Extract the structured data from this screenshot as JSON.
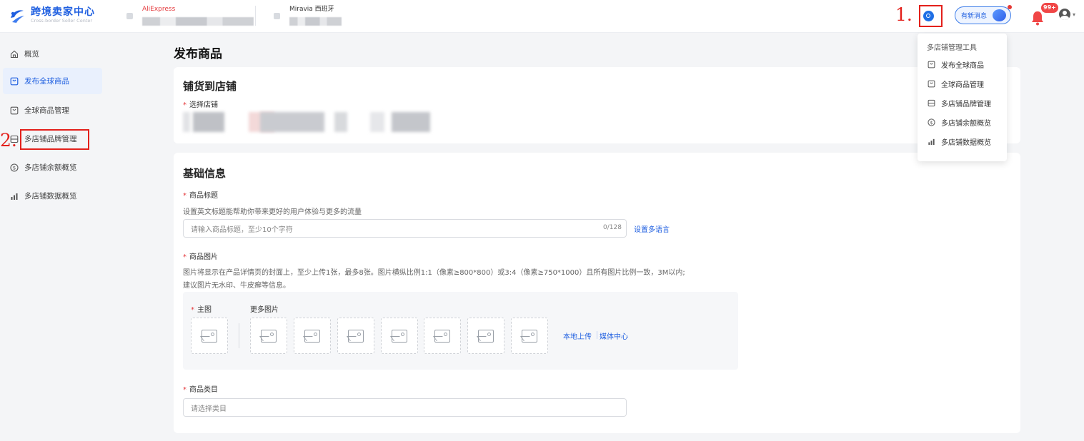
{
  "header": {
    "logo_title": "跨境卖家中心",
    "logo_subtitle": "Cross-border Seller Center",
    "stores": [
      {
        "name": "AliExpress",
        "color": "#e4393c"
      },
      {
        "name": "Miravia 西班牙",
        "color": "#333333"
      }
    ],
    "news_label": "有新消息",
    "notification_badge": "99+",
    "annotation_1": "1."
  },
  "sidebar": {
    "items": [
      {
        "label": "概览",
        "icon": "home-icon"
      },
      {
        "label": "发布全球商品",
        "icon": "bag-icon",
        "active": true
      },
      {
        "label": "全球商品管理",
        "icon": "bag-icon"
      },
      {
        "label": "多店铺品牌管理",
        "icon": "brand-icon"
      },
      {
        "label": "多店铺余额概览",
        "icon": "dollar-icon"
      },
      {
        "label": "多店铺数据概览",
        "icon": "chart-icon"
      }
    ],
    "annotation_2": "2."
  },
  "main": {
    "page_title": "发布商品",
    "distribute": {
      "title": "铺货到店铺",
      "select_store_label": "选择店铺"
    },
    "basic": {
      "title": "基础信息",
      "product_title_label": "商品标题",
      "product_title_hint": "设置英文标题能帮助你带来更好的用户体验与更多的流量",
      "product_title_placeholder": "请输入商品标题，至少10个字符",
      "product_title_counter": "0/128",
      "set_languages_link": "设置多语言",
      "images_label": "商品图片",
      "images_hint_1": "图片将显示在产品详情页的封面上，至少上传1张，最多8张。图片横纵比例1:1（像素≥800*800）或3:4（像素≥750*1000）且所有图片比例一致，3M以内;",
      "images_hint_2": "建议图片无水印、牛皮癣等信息。",
      "main_image_label": "主图",
      "more_images_label": "更多图片",
      "local_upload_link": "本地上传",
      "media_center_link": "媒体中心",
      "category_label": "商品类目",
      "category_placeholder": "请选择类目"
    }
  },
  "dropdown": {
    "title": "多店铺管理工具",
    "items": [
      {
        "label": "发布全球商品",
        "icon": "bag-icon"
      },
      {
        "label": "全球商品管理",
        "icon": "bag-icon"
      },
      {
        "label": "多店铺品牌管理",
        "icon": "brand-icon"
      },
      {
        "label": "多店铺余额概览",
        "icon": "dollar-icon"
      },
      {
        "label": "多店铺数据概览",
        "icon": "chart-icon"
      }
    ]
  },
  "colors": {
    "primary": "#1f5fe0",
    "required": "#e4393c",
    "annotation": "#e3201b",
    "badge": "#f04646"
  }
}
